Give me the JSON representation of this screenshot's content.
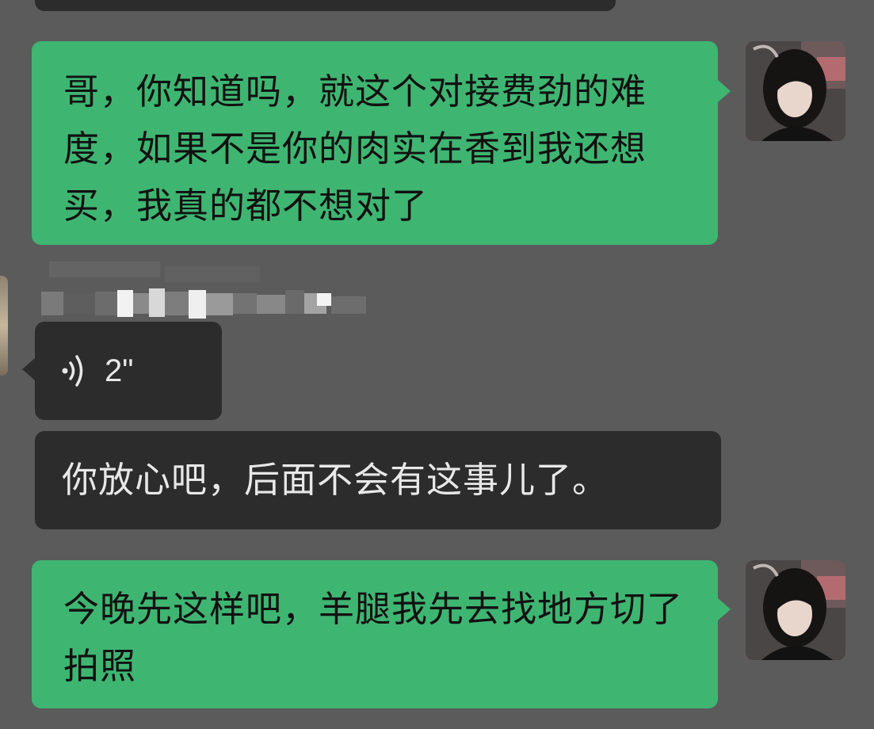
{
  "conversation": {
    "messages": [
      {
        "side": "right",
        "type": "text",
        "text": "哥，你知道吗，就这个对接费劲的难度，如果不是你的肉实在香到我还想买，我真的都不想对了"
      },
      {
        "side": "left",
        "type": "voice",
        "duration": "2\""
      },
      {
        "side": "left",
        "type": "text",
        "text": "你放心吧，后面不会有这事儿了。"
      },
      {
        "side": "right",
        "type": "text",
        "text": "今晚先这样吧，羊腿我先去找地方切了拍照"
      }
    ]
  },
  "icons": {
    "voice": "voice-wave-icon",
    "self_avatar": "user-avatar",
    "peer_avatar": "contact-avatar"
  },
  "colors": {
    "background": "#5b5b5b",
    "self_bubble": "#3fb572",
    "peer_bubble": "#2c2c2c",
    "peer_text": "#e8e8e8"
  }
}
